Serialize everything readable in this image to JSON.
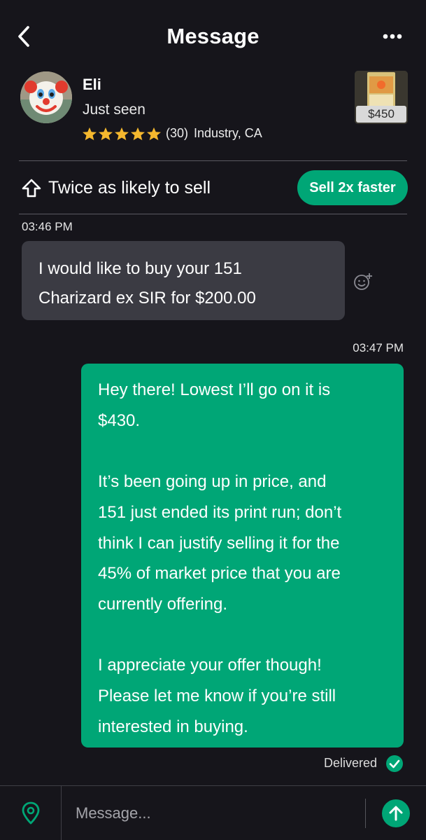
{
  "header": {
    "title": "Message",
    "back_icon": "chevron-left-icon",
    "more_icon": "more-dots-icon"
  },
  "seller": {
    "name": "Eli",
    "status": "Just seen",
    "rating_stars": 5,
    "review_count": "(30)",
    "location": "Industry, CA",
    "star_color": "#f5b82e"
  },
  "listing": {
    "price": "$450"
  },
  "promo": {
    "text": "Twice as likely to sell",
    "button_label": "Sell 2x faster",
    "icon": "arrow-up-outline-icon"
  },
  "messages": [
    {
      "time": "03:46 PM",
      "direction": "incoming",
      "lines": [
        "I would like to buy your 151",
        "Charizard ex SIR for $200.00"
      ]
    },
    {
      "time": "03:47 PM",
      "direction": "outgoing",
      "paragraphs": [
        [
          "Hey there! Lowest I’ll go on it is",
          "$430."
        ],
        [
          "It’s been going up in price, and",
          "151 just ended its print run; don’t",
          "think I can justify selling it for the",
          "45% of market price that you are",
          "currently offering."
        ],
        [
          "I appreciate your offer though!",
          "Please let me know if you’re still",
          "interested in buying."
        ]
      ],
      "status": "Delivered"
    }
  ],
  "composer": {
    "placeholder": "Message...",
    "location_icon": "location-pin-icon",
    "send_icon": "send-arrow-up-icon"
  },
  "colors": {
    "background": "#16151b",
    "accent": "#00a676",
    "incoming_bubble": "#3b3b43"
  }
}
